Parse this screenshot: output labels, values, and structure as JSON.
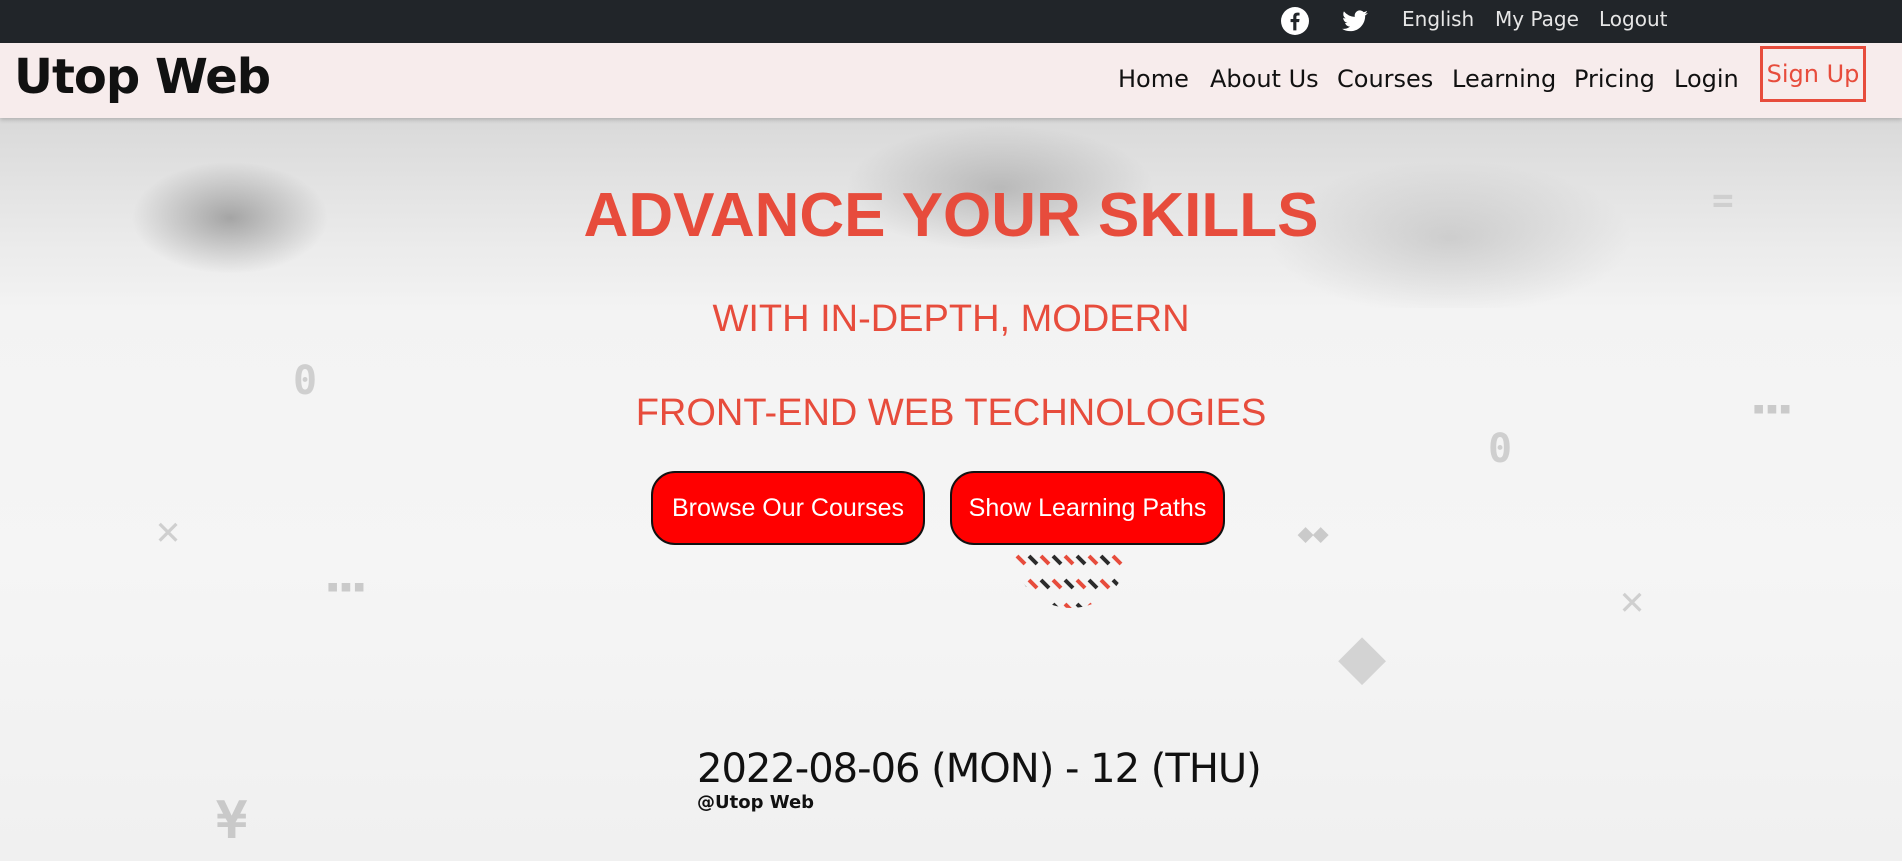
{
  "topbar": {
    "social": [
      {
        "name": "facebook-icon"
      },
      {
        "name": "twitter-icon"
      }
    ],
    "links": [
      "English",
      "My Page",
      "Logout"
    ]
  },
  "navbar": {
    "brand": "Utop Web",
    "links": [
      "Home",
      "About Us",
      "Courses",
      "Learning",
      "Pricing",
      "Login"
    ],
    "signup": "Sign Up"
  },
  "hero": {
    "headline": "ADVANCE YOUR SKILLS",
    "subline1": "WITH IN-DEPTH, MODERN",
    "subline2": "FRONT-END WEB TECHNOLOGIES",
    "buttons": [
      "Browse Our Courses",
      "Show Learning Paths"
    ],
    "event_date": "2022-08-06 (MON) - 12 (THU)",
    "event_host": "@Utop Web"
  },
  "colors": {
    "accent": "#e74c3c",
    "cta": "#ff0000",
    "topbar": "#212529",
    "navbar": "#f7ecec"
  }
}
